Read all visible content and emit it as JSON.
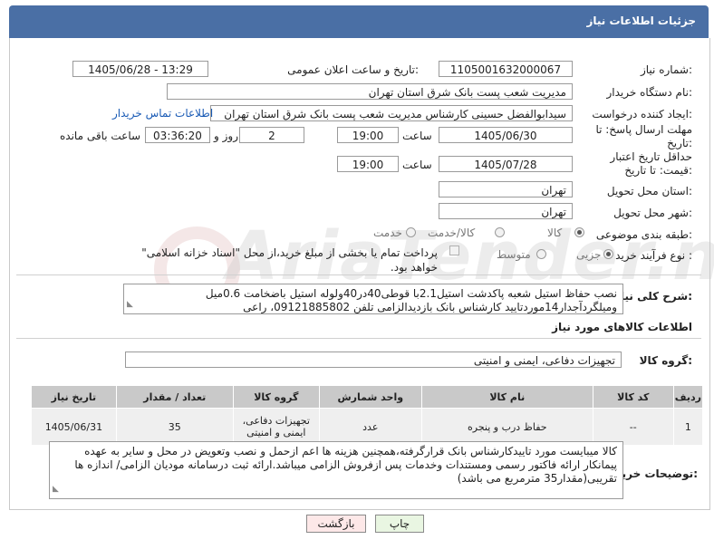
{
  "header": {
    "title": "جزئیات اطلاعات نیاز"
  },
  "fields": {
    "need_number_label": "شماره نیاز:",
    "need_number": "1105001632000067",
    "announce_label": "تاریخ و ساعت اعلان عمومی:",
    "announce_value": "1405/06/28 - 13:29",
    "buyer_org_label": "نام دستگاه خریدار:",
    "buyer_org": "مدیریت شعب پست بانک شرق استان تهران",
    "creator_label": "ایجاد کننده درخواست:",
    "creator": "سیدابوالفضل حسینی کارشناس مدیریت شعب پست بانک شرق استان تهران",
    "contact_link": "اطلاعات تماس خریدار",
    "reply_deadline_label": "مهلت ارسال پاسخ: تا تاریخ:",
    "reply_date": "1405/06/30",
    "time_label": "ساعت",
    "reply_time": "19:00",
    "days_value": "2",
    "days_label": "روز و",
    "remaining_time": "03:36:20",
    "remaining_label": "ساعت باقی مانده",
    "price_deadline_label": "حداقل تاریخ اعتبار قیمت: تا تاریخ:",
    "price_date": "1405/07/28",
    "price_time": "19:00",
    "province_label": "استان محل تحویل:",
    "province": "تهران",
    "city_label": "شهر محل تحویل:",
    "city": "تهران",
    "category_label": "طبقه بندی موضوعی:",
    "category_options": [
      "کالا",
      "کالا/خدمت",
      "خدمت"
    ],
    "process_label": "نوع فرآیند خرید :",
    "process_options": [
      "جزیی",
      "متوسط"
    ],
    "payment_note": "پرداخت تمام یا بخشی از مبلغ خرید،از محل \"اسناد خزانه اسلامی\" خواهد بود."
  },
  "description": {
    "label": "شرح کلی نیاز:",
    "text": "نصب حفاظ استیل شعبه پاکدشت استیل2.1با قوطی40در40ولوله استیل باضخامت 0.6میل وميلگردآجدار14موردتایید کارشناس بانک بازدیدالزامی تلفن 09121885802، راعی"
  },
  "goods_section": {
    "title": "اطلاعات کالاهای مورد نیاز",
    "group_label": "گروه کالا:",
    "group_value": "تجهیزات دفاعی، ایمنی و امنیتی"
  },
  "table": {
    "headers": [
      "ردیف",
      "کد کالا",
      "نام کالا",
      "واحد شمارش",
      "گروه کالا",
      "تعداد / مقدار",
      "تاریخ نیاز"
    ],
    "rows": [
      [
        "1",
        "--",
        "حفاظ درب و پنجره",
        "عدد",
        "تجهیزات دفاعی، ایمنی و امنیتی",
        "35",
        "1405/06/31"
      ]
    ]
  },
  "buyer_notes": {
    "label": "توضیحات خریدار:",
    "text": "کالا میبایست مورد تاییدکارشناس بانک قرارگرفته،همچنین هزینه ها اعم ازحمل و نصب وتعویض در محل و سایر به عهده پیمانکار ارائه فاکتور رسمی ومستندات وخدمات پس ازفروش الزامی میباشد.ارائه ثبت درسامانه مودیان الزامی/ اندازه ها تقریبی(مقدار35 مترمربع می باشد)"
  },
  "buttons": {
    "print": "چاپ",
    "back": "بازگشت"
  },
  "watermark": "AriaTender.net",
  "colors": {
    "header": "#4a6fa5",
    "link": "#1a5bb5",
    "back_bg": "#fde8e8",
    "print_bg": "#e9f6e2"
  }
}
